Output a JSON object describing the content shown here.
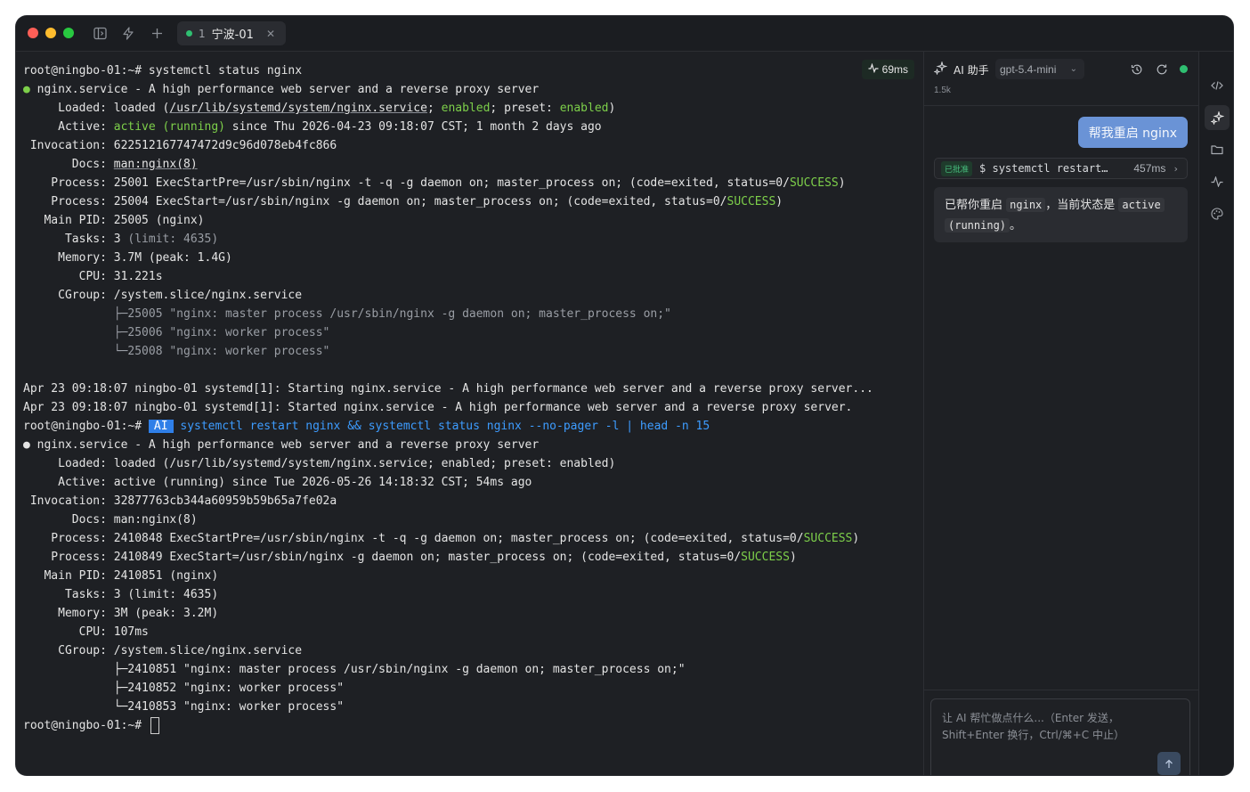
{
  "window": {
    "tab": {
      "index": "1",
      "name": "宁波-01",
      "status_color": "#2fbf71"
    }
  },
  "terminal": {
    "latency": "69ms",
    "lines": [
      [
        {
          "t": "root@ningbo-01:~# systemctl status nginx"
        }
      ],
      [
        {
          "t": "● ",
          "c": "g"
        },
        {
          "t": "nginx.service - A high performance web server and a reverse proxy server"
        }
      ],
      [
        {
          "t": "     Loaded: loaded ("
        },
        {
          "t": "/usr/lib/systemd/system/nginx.service",
          "c": "u"
        },
        {
          "t": "; "
        },
        {
          "t": "enabled",
          "c": "g"
        },
        {
          "t": "; preset: "
        },
        {
          "t": "enabled",
          "c": "g"
        },
        {
          "t": ")"
        }
      ],
      [
        {
          "t": "     Active: "
        },
        {
          "t": "active (running)",
          "c": "g"
        },
        {
          "t": " since Thu 2026-04-23 09:18:07 CST; 1 month 2 days ago"
        }
      ],
      [
        {
          "t": " Invocation: 622512167747472d9c96d078eb4fc866"
        }
      ],
      [
        {
          "t": "       Docs: "
        },
        {
          "t": "man:nginx(8)",
          "c": "u"
        }
      ],
      [
        {
          "t": "    Process: 25001 ExecStartPre=/usr/sbin/nginx -t -q -g daemon on; master_process on; (code=exited, status=0/"
        },
        {
          "t": "SUCCESS",
          "c": "g"
        },
        {
          "t": ")"
        }
      ],
      [
        {
          "t": "    Process: 25004 ExecStart=/usr/sbin/nginx -g daemon on; master_process on; (code=exited, status=0/"
        },
        {
          "t": "SUCCESS",
          "c": "g"
        },
        {
          "t": ")"
        }
      ],
      [
        {
          "t": "   Main PID: 25005 (nginx)"
        }
      ],
      [
        {
          "t": "      Tasks: 3 "
        },
        {
          "t": "(limit: 4635)",
          "c": "gr"
        }
      ],
      [
        {
          "t": "     Memory: 3.7M (peak: 1.4G)"
        }
      ],
      [
        {
          "t": "        CPU: 31.221s"
        }
      ],
      [
        {
          "t": "     CGroup: /system.slice/nginx.service"
        }
      ],
      [
        {
          "t": "             ├─25005 \"nginx: master process /usr/sbin/nginx -g daemon on; master_process on;\"",
          "c": "gr"
        }
      ],
      [
        {
          "t": "             ├─25006 \"nginx: worker process\"",
          "c": "gr"
        }
      ],
      [
        {
          "t": "             └─25008 \"nginx: worker process\"",
          "c": "gr"
        }
      ],
      [
        {
          "t": ""
        }
      ],
      [
        {
          "t": "Apr 23 09:18:07 ningbo-01 systemd[1]: Starting nginx.service - A high performance web server and a reverse proxy server..."
        }
      ],
      [
        {
          "t": "Apr 23 09:18:07 ningbo-01 systemd[1]: Started nginx.service - A high performance web server and a reverse proxy server."
        }
      ],
      [
        {
          "t": "root@ningbo-01:~# "
        },
        {
          "t": "AI",
          "c": "ai"
        },
        {
          "t": " systemctl restart nginx && systemctl status nginx --no-pager -l | head -n 15",
          "c": "b"
        }
      ],
      [
        {
          "t": "● nginx.service - A high performance web server and a reverse proxy server"
        }
      ],
      [
        {
          "t": "     Loaded: loaded (/usr/lib/systemd/system/nginx.service; enabled; preset: enabled)"
        }
      ],
      [
        {
          "t": "     Active: active (running) since Tue 2026-05-26 14:18:32 CST; 54ms ago"
        }
      ],
      [
        {
          "t": " Invocation: 32877763cb344a60959b59b65a7fe02a"
        }
      ],
      [
        {
          "t": "       Docs: man:nginx(8)"
        }
      ],
      [
        {
          "t": "    Process: 2410848 ExecStartPre=/usr/sbin/nginx -t -q -g daemon on; master_process on; (code=exited, status=0/"
        },
        {
          "t": "SUCCESS",
          "c": "g"
        },
        {
          "t": ")"
        }
      ],
      [
        {
          "t": "    Process: 2410849 ExecStart=/usr/sbin/nginx -g daemon on; master_process on; (code=exited, status=0/"
        },
        {
          "t": "SUCCESS",
          "c": "g"
        },
        {
          "t": ")"
        }
      ],
      [
        {
          "t": "   Main PID: 2410851 (nginx)"
        }
      ],
      [
        {
          "t": "      Tasks: 3 (limit: 4635)"
        }
      ],
      [
        {
          "t": "     Memory: 3M (peak: 3.2M)"
        }
      ],
      [
        {
          "t": "        CPU: 107ms"
        }
      ],
      [
        {
          "t": "     CGroup: /system.slice/nginx.service"
        }
      ],
      [
        {
          "t": "             ├─2410851 \"nginx: master process /usr/sbin/nginx -g daemon on; master_process on;\""
        }
      ],
      [
        {
          "t": "             ├─2410852 \"nginx: worker process\""
        }
      ],
      [
        {
          "t": "             └─2410853 \"nginx: worker process\""
        }
      ],
      [
        {
          "t": "root@ningbo-01:~# "
        },
        {
          "cursor": true
        }
      ]
    ]
  },
  "ai_panel": {
    "title": "AI 助手",
    "model": "gpt-5.4-mini",
    "tokens": "1.5k",
    "user_message": "帮我重启 nginx",
    "tool_call": {
      "badge": "已批准",
      "command": "$ systemctl restart…",
      "duration": "457ms"
    },
    "reply": {
      "p1": "已帮你重启 ",
      "code1": "nginx",
      "p2": "，当前状态是 ",
      "code2": "active",
      "code3": "(running)",
      "p3": "。"
    },
    "composer": {
      "placeholder": "让 AI 帮忙做点什么...（Enter 发送，Shift+Enter 换行，Ctrl/⌘+C 中止）"
    }
  },
  "colors": {
    "accent": "#2f7fe8",
    "success": "#2fbf71",
    "terminal_green": "#7dcf4a",
    "user_bubble": "#6a93d6"
  }
}
